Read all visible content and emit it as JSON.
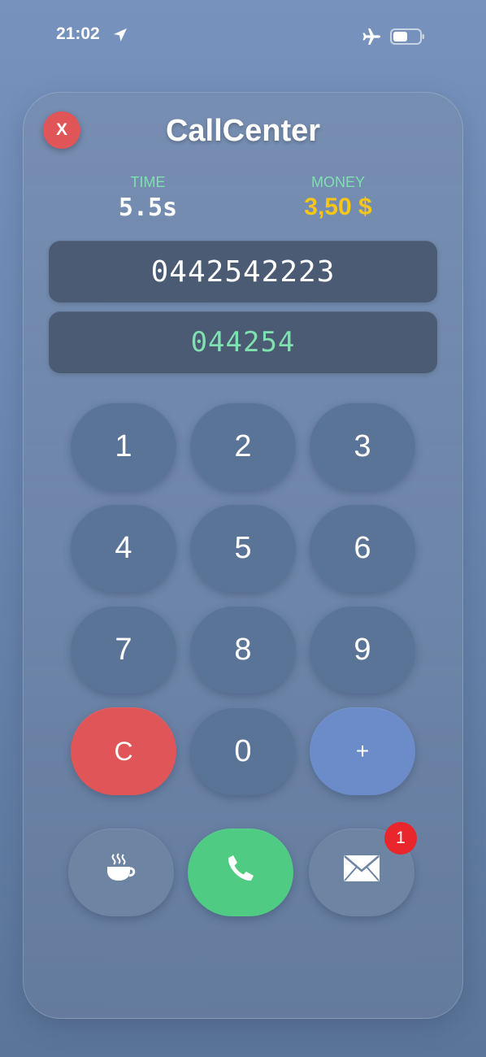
{
  "status_bar": {
    "time": "21:02",
    "icons": [
      "location-arrow-icon",
      "airplane-mode-icon",
      "battery-icon"
    ]
  },
  "app": {
    "title": "CallCenter",
    "close_label": "X"
  },
  "stats": {
    "time_label": "TIME",
    "time_value": "5.5s",
    "money_label": "MONEY",
    "money_value": "3,50 $"
  },
  "display": {
    "target_number": "0442542223",
    "typed_number": "044254"
  },
  "keypad": {
    "keys": [
      "1",
      "2",
      "3",
      "4",
      "5",
      "6",
      "7",
      "8",
      "9",
      "C",
      "0",
      "+"
    ]
  },
  "actions": {
    "coffee_icon": "coffee-cup-icon",
    "call_icon": "phone-icon",
    "mail_icon": "envelope-icon",
    "mail_badge": "1"
  },
  "colors": {
    "accent_green": "#4fcb83",
    "clear_red": "#e05557",
    "plus_blue": "#6b8cc9",
    "money_yellow": "#f5c518",
    "label_mint": "#7fe0b0"
  }
}
